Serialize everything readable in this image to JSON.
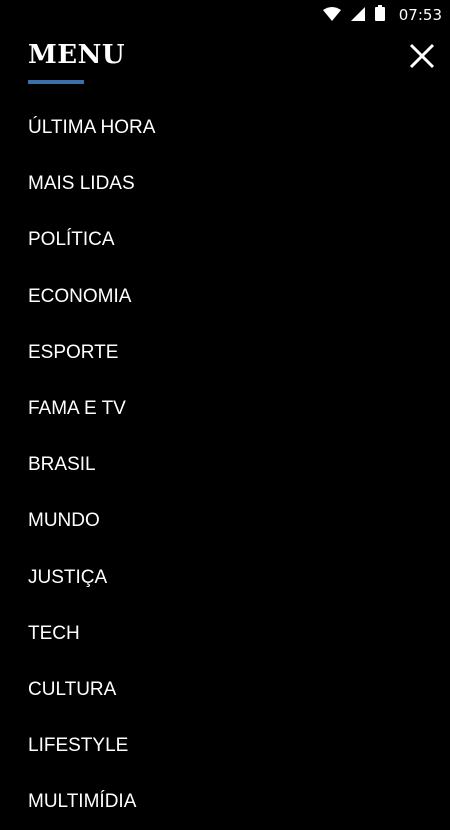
{
  "status_bar": {
    "time": "07:53",
    "icons": [
      "wifi-icon",
      "signal-icon",
      "battery-icon"
    ]
  },
  "menu": {
    "title": "MENU",
    "accent_color": "#3b6fa8",
    "items": [
      {
        "label": "ÚLTIMA HORA"
      },
      {
        "label": "MAIS LIDAS"
      },
      {
        "label": "POLÍTICA"
      },
      {
        "label": "ECONOMIA"
      },
      {
        "label": "ESPORTE"
      },
      {
        "label": "FAMA E TV"
      },
      {
        "label": "BRASIL"
      },
      {
        "label": "MUNDO"
      },
      {
        "label": "JUSTIÇA"
      },
      {
        "label": "TECH"
      },
      {
        "label": "CULTURA"
      },
      {
        "label": "LIFESTYLE"
      },
      {
        "label": "MULTIMÍDIA"
      }
    ]
  }
}
